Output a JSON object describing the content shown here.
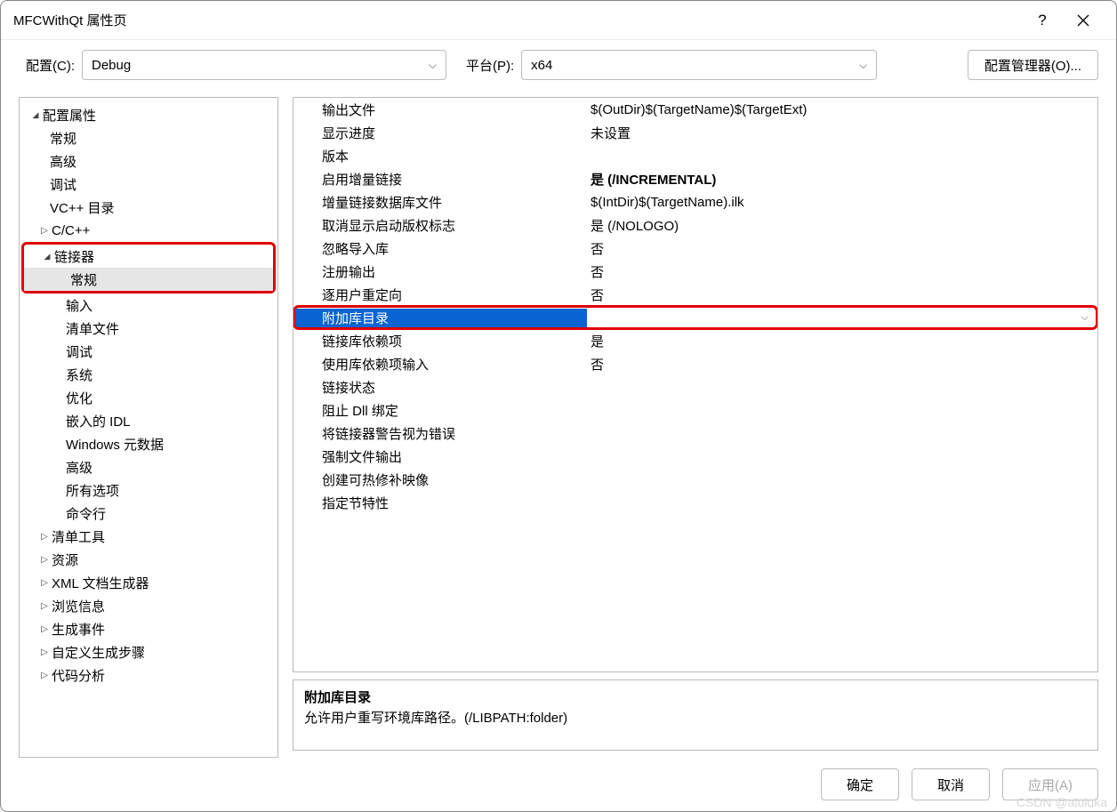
{
  "window": {
    "title": "MFCWithQt 属性页"
  },
  "toolbar": {
    "config_label": "配置(C):",
    "config_value": "Debug",
    "platform_label": "平台(P):",
    "platform_value": "x64",
    "config_manager": "配置管理器(O)..."
  },
  "tree": {
    "root": "配置属性",
    "general": "常规",
    "advanced": "高级",
    "debugging": "调试",
    "vcpp_dirs": "VC++ 目录",
    "ccpp": "C/C++",
    "linker": "链接器",
    "linker_children": {
      "general": "常规",
      "input": "输入",
      "manifest": "清单文件",
      "debugging": "调试",
      "system": "系统",
      "optimization": "优化",
      "embedded_idl": "嵌入的 IDL",
      "win_meta": "Windows 元数据",
      "advanced": "高级",
      "all_options": "所有选项",
      "command_line": "命令行"
    },
    "manifest_tool": "清单工具",
    "resources": "资源",
    "xml_doc": "XML 文档生成器",
    "browse_info": "浏览信息",
    "build_events": "生成事件",
    "custom_build": "自定义生成步骤",
    "code_analysis": "代码分析"
  },
  "props": [
    {
      "name": "输出文件",
      "value": "$(OutDir)$(TargetName)$(TargetExt)"
    },
    {
      "name": "显示进度",
      "value": "未设置"
    },
    {
      "name": "版本",
      "value": ""
    },
    {
      "name": "启用增量链接",
      "value": "是 (/INCREMENTAL)",
      "bold": true
    },
    {
      "name": "增量链接数据库文件",
      "value": "$(IntDir)$(TargetName).ilk"
    },
    {
      "name": "取消显示启动版权标志",
      "value": "是 (/NOLOGO)"
    },
    {
      "name": "忽略导入库",
      "value": "否"
    },
    {
      "name": "注册输出",
      "value": "否"
    },
    {
      "name": "逐用户重定向",
      "value": "否"
    },
    {
      "name": "附加库目录",
      "value": "",
      "selected": true
    },
    {
      "name": "链接库依赖项",
      "value": "是"
    },
    {
      "name": "使用库依赖项输入",
      "value": "否"
    },
    {
      "name": "链接状态",
      "value": ""
    },
    {
      "name": "阻止 Dll 绑定",
      "value": ""
    },
    {
      "name": "将链接器警告视为错误",
      "value": ""
    },
    {
      "name": "强制文件输出",
      "value": ""
    },
    {
      "name": "创建可热修补映像",
      "value": ""
    },
    {
      "name": "指定节特性",
      "value": ""
    }
  ],
  "description": {
    "title": "附加库目录",
    "body": "允许用户重写环境库路径。(/LIBPATH:folder)"
  },
  "footer": {
    "ok": "确定",
    "cancel": "取消",
    "apply": "应用(A)"
  },
  "watermark": "CSDN @aluluka"
}
